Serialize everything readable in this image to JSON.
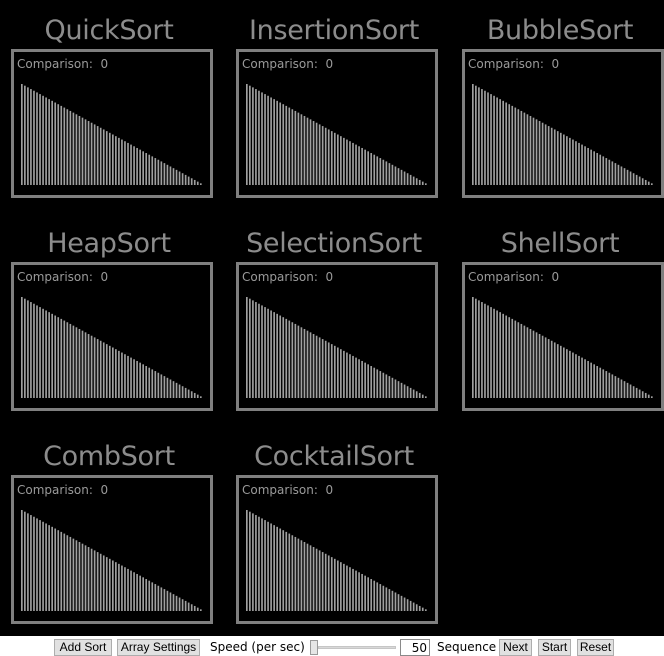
{
  "comparison_label": "Comparison:",
  "bar_color": "#a0a0a0",
  "bar_values": [
    60,
    59,
    58,
    57,
    56,
    55,
    54,
    53,
    52,
    51,
    50,
    49,
    48,
    47,
    46,
    45,
    44,
    43,
    42,
    41,
    40,
    39,
    38,
    37,
    36,
    35,
    34,
    33,
    32,
    31,
    30,
    29,
    28,
    27,
    26,
    25,
    24,
    23,
    22,
    21,
    20,
    19,
    18,
    17,
    16,
    15,
    14,
    13,
    12,
    11,
    10,
    9,
    8,
    7,
    6,
    5,
    4,
    3,
    2,
    1
  ],
  "panels": [
    {
      "title": "QuickSort",
      "comparisons": "0"
    },
    {
      "title": "InsertionSort",
      "comparisons": "0"
    },
    {
      "title": "BubbleSort",
      "comparisons": "0"
    },
    {
      "title": "HeapSort",
      "comparisons": "0"
    },
    {
      "title": "SelectionSort",
      "comparisons": "0"
    },
    {
      "title": "ShellSort",
      "comparisons": "0"
    },
    {
      "title": "CombSort",
      "comparisons": "0"
    },
    {
      "title": "CocktailSort",
      "comparisons": "0"
    }
  ],
  "toolbar": {
    "add_sort": "Add Sort",
    "array_settings": "Array Settings",
    "speed_label": "Speed (per sec)",
    "speed_value": "50",
    "sequence_label": "Sequence",
    "next": "Next",
    "start": "Start",
    "reset": "Reset"
  }
}
